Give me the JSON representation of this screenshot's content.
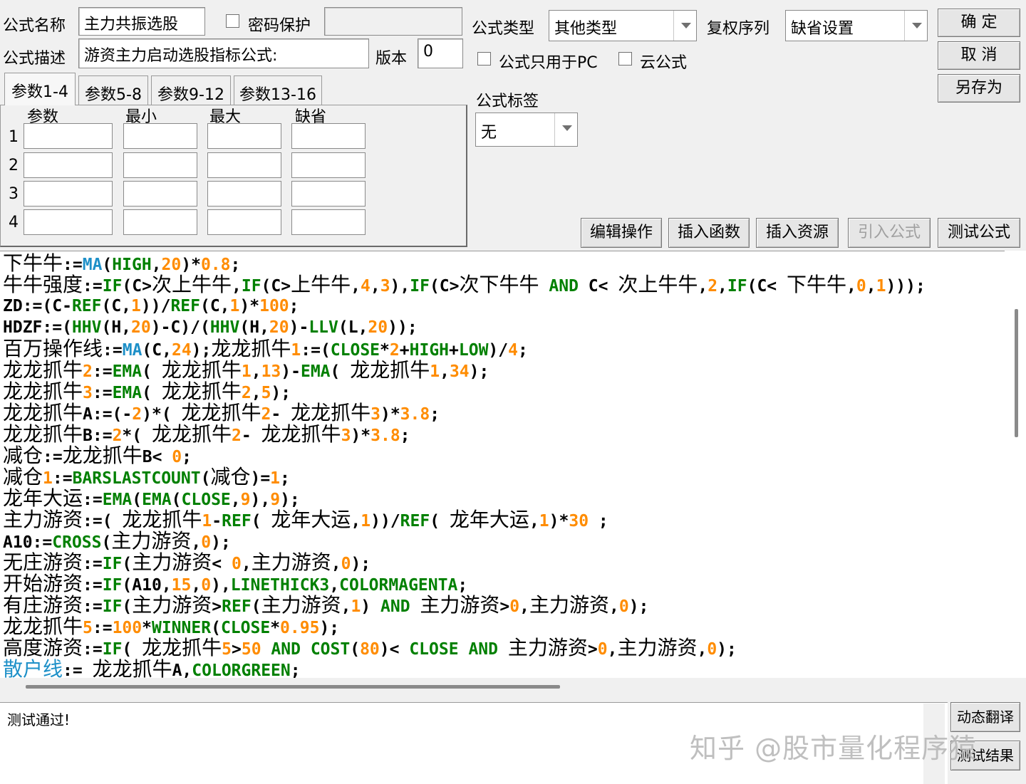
{
  "form": {
    "name_label": "公式名称",
    "name_value": "主力共振选股",
    "password_label": "密码保护",
    "desc_label": "公式描述",
    "desc_value": "游资主力启动选股指标公式:",
    "version_label": "版本",
    "version_value": "0",
    "type_label": "公式类型",
    "type_value": "其他类型",
    "rights_label": "复权序列",
    "rights_value": "缺省设置",
    "pc_only_label": "公式只用于PC",
    "cloud_label": "云公式",
    "tag_label": "公式标签",
    "tag_value": "无"
  },
  "buttons": {
    "ok": "确 定",
    "cancel": "取 消",
    "save_as": "另存为",
    "edit_ops": "编辑操作",
    "insert_func": "插入函数",
    "insert_res": "插入资源",
    "import_formula": "引入公式",
    "test_formula": "测试公式",
    "dyn_translate": "动态翻译",
    "test_result": "测试结果"
  },
  "tabs": [
    "参数1-4",
    "参数5-8",
    "参数9-12",
    "参数13-16"
  ],
  "params": {
    "headers": [
      "参数",
      "最小",
      "最大",
      "缺省"
    ],
    "rows": [
      "1",
      "2",
      "3",
      "4"
    ]
  },
  "output": {
    "message": "测试通过!"
  },
  "watermark": "知乎 @股市量化程序猿",
  "code_lines": [
    "下牛牛:=MA(HIGH,20)*0.8;",
    "牛牛强度:=IF(C>次上牛牛,IF(C>上牛牛,4,3),IF(C>次下牛牛 AND C< 次上牛牛,2,IF(C< 下牛牛,0,1)));",
    "ZD:=(C-REF(C,1))/REF(C,1)*100;",
    "HDZF:=(HHV(H,20)-C)/(HHV(H,20)-LLV(L,20));",
    "百万操作线:=MA(C,24);龙龙抓牛1:=(CLOSE*2+HIGH+LOW)/4;",
    "龙龙抓牛2:=EMA( 龙龙抓牛1,13)-EMA( 龙龙抓牛1,34);",
    "龙龙抓牛3:=EMA( 龙龙抓牛2,5);",
    "龙龙抓牛A:=(-2)*( 龙龙抓牛2- 龙龙抓牛3)*3.8;",
    "龙龙抓牛B:=2*( 龙龙抓牛2- 龙龙抓牛3)*3.8;",
    "减仓:=龙龙抓牛B< 0;",
    "减仓1:=BARSLASTCOUNT(减仓)=1;",
    "龙年大运:=EMA(EMA(CLOSE,9),9);",
    "主力游资:=( 龙龙抓牛1-REF( 龙年大运,1))/REF( 龙年大运,1)*30 ;",
    "A10:=CROSS(主力游资,0);",
    "无庄游资:=IF(主力游资< 0,主力游资,0);",
    "开始游资:=IF(A10,15,0),LINETHICK3,COLORMAGENTA;",
    "有庄游资:=IF(主力游资>REF(主力游资,1) AND 主力游资>0,主力游资,0);",
    "龙龙抓牛5:=100*WINNER(CLOSE*0.95);",
    "高度游资:=IF( 龙龙抓牛5>50 AND COST(80)< CLOSE AND 主力游资>0,主力游资,0);",
    "散户线:= 龙龙抓牛A,COLORGREEN;"
  ],
  "colors": {
    "keyword": "#008000",
    "number": "#ff8c00",
    "builtin": "#1e90c8",
    "text": "#000000"
  }
}
